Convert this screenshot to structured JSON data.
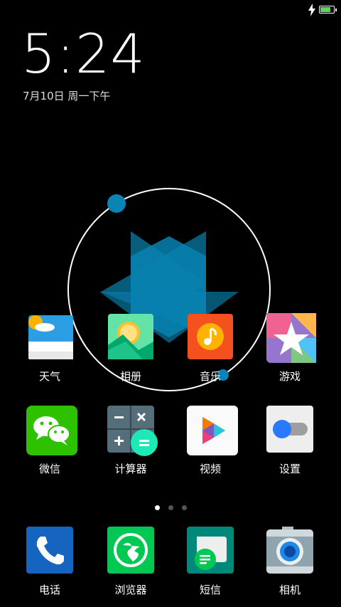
{
  "status_bar": {
    "battery_level": 0.85,
    "charging": true
  },
  "clock": {
    "time": "5:24",
    "date": "7月10日 周一下午"
  },
  "apps_row1": [
    {
      "id": "weather",
      "label": "天气"
    },
    {
      "id": "gallery",
      "label": "相册"
    },
    {
      "id": "music",
      "label": "音乐"
    },
    {
      "id": "games",
      "label": "游戏"
    }
  ],
  "apps_row2": [
    {
      "id": "wechat",
      "label": "微信"
    },
    {
      "id": "calculator",
      "label": "计算器"
    },
    {
      "id": "video",
      "label": "视频"
    },
    {
      "id": "settings",
      "label": "设置"
    }
  ],
  "dock": [
    {
      "id": "phone",
      "label": "电话"
    },
    {
      "id": "browser",
      "label": "浏览器"
    },
    {
      "id": "messages",
      "label": "短信"
    },
    {
      "id": "camera",
      "label": "相机"
    }
  ],
  "pager": {
    "pages": 3,
    "current": 1
  },
  "colors": {
    "accent_blue": "#0a83b5",
    "background": "#000000"
  }
}
